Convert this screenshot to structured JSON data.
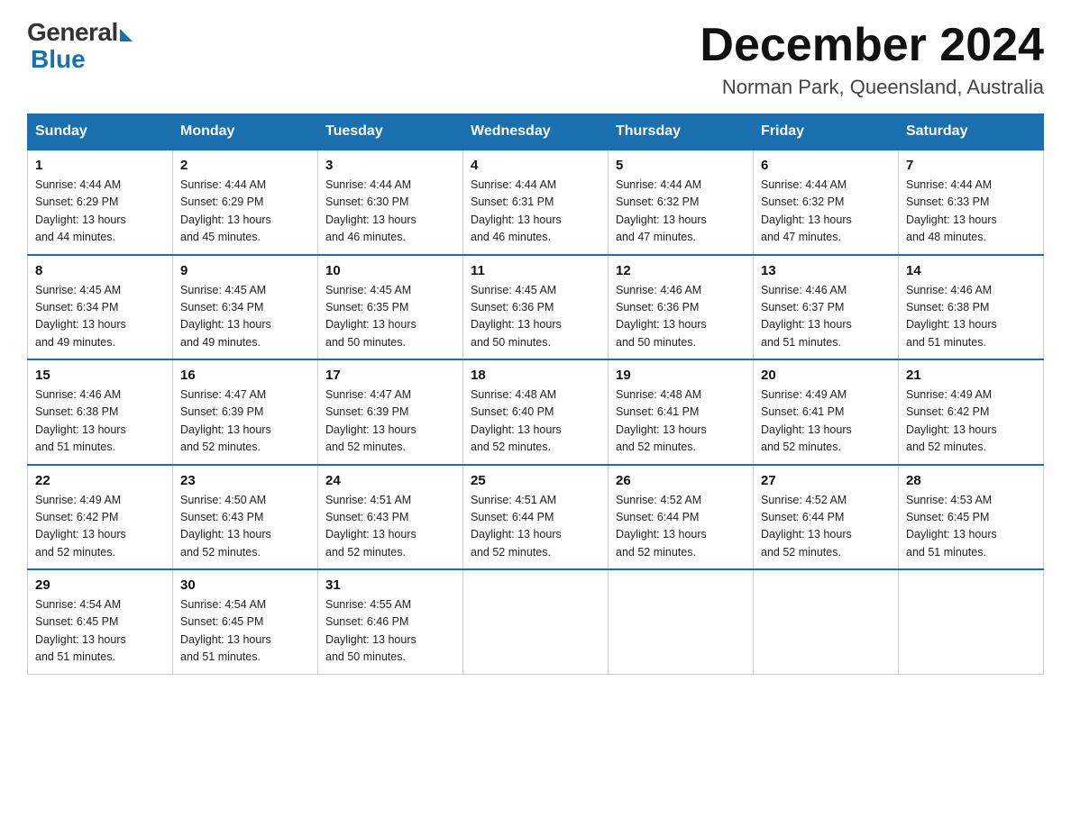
{
  "logo": {
    "general": "General",
    "blue": "Blue"
  },
  "title": "December 2024",
  "location": "Norman Park, Queensland, Australia",
  "days_of_week": [
    "Sunday",
    "Monday",
    "Tuesday",
    "Wednesday",
    "Thursday",
    "Friday",
    "Saturday"
  ],
  "weeks": [
    [
      {
        "day": "1",
        "sunrise": "4:44 AM",
        "sunset": "6:29 PM",
        "daylight": "13 hours and 44 minutes."
      },
      {
        "day": "2",
        "sunrise": "4:44 AM",
        "sunset": "6:29 PM",
        "daylight": "13 hours and 45 minutes."
      },
      {
        "day": "3",
        "sunrise": "4:44 AM",
        "sunset": "6:30 PM",
        "daylight": "13 hours and 46 minutes."
      },
      {
        "day": "4",
        "sunrise": "4:44 AM",
        "sunset": "6:31 PM",
        "daylight": "13 hours and 46 minutes."
      },
      {
        "day": "5",
        "sunrise": "4:44 AM",
        "sunset": "6:32 PM",
        "daylight": "13 hours and 47 minutes."
      },
      {
        "day": "6",
        "sunrise": "4:44 AM",
        "sunset": "6:32 PM",
        "daylight": "13 hours and 47 minutes."
      },
      {
        "day": "7",
        "sunrise": "4:44 AM",
        "sunset": "6:33 PM",
        "daylight": "13 hours and 48 minutes."
      }
    ],
    [
      {
        "day": "8",
        "sunrise": "4:45 AM",
        "sunset": "6:34 PM",
        "daylight": "13 hours and 49 minutes."
      },
      {
        "day": "9",
        "sunrise": "4:45 AM",
        "sunset": "6:34 PM",
        "daylight": "13 hours and 49 minutes."
      },
      {
        "day": "10",
        "sunrise": "4:45 AM",
        "sunset": "6:35 PM",
        "daylight": "13 hours and 50 minutes."
      },
      {
        "day": "11",
        "sunrise": "4:45 AM",
        "sunset": "6:36 PM",
        "daylight": "13 hours and 50 minutes."
      },
      {
        "day": "12",
        "sunrise": "4:46 AM",
        "sunset": "6:36 PM",
        "daylight": "13 hours and 50 minutes."
      },
      {
        "day": "13",
        "sunrise": "4:46 AM",
        "sunset": "6:37 PM",
        "daylight": "13 hours and 51 minutes."
      },
      {
        "day": "14",
        "sunrise": "4:46 AM",
        "sunset": "6:38 PM",
        "daylight": "13 hours and 51 minutes."
      }
    ],
    [
      {
        "day": "15",
        "sunrise": "4:46 AM",
        "sunset": "6:38 PM",
        "daylight": "13 hours and 51 minutes."
      },
      {
        "day": "16",
        "sunrise": "4:47 AM",
        "sunset": "6:39 PM",
        "daylight": "13 hours and 52 minutes."
      },
      {
        "day": "17",
        "sunrise": "4:47 AM",
        "sunset": "6:39 PM",
        "daylight": "13 hours and 52 minutes."
      },
      {
        "day": "18",
        "sunrise": "4:48 AM",
        "sunset": "6:40 PM",
        "daylight": "13 hours and 52 minutes."
      },
      {
        "day": "19",
        "sunrise": "4:48 AM",
        "sunset": "6:41 PM",
        "daylight": "13 hours and 52 minutes."
      },
      {
        "day": "20",
        "sunrise": "4:49 AM",
        "sunset": "6:41 PM",
        "daylight": "13 hours and 52 minutes."
      },
      {
        "day": "21",
        "sunrise": "4:49 AM",
        "sunset": "6:42 PM",
        "daylight": "13 hours and 52 minutes."
      }
    ],
    [
      {
        "day": "22",
        "sunrise": "4:49 AM",
        "sunset": "6:42 PM",
        "daylight": "13 hours and 52 minutes."
      },
      {
        "day": "23",
        "sunrise": "4:50 AM",
        "sunset": "6:43 PM",
        "daylight": "13 hours and 52 minutes."
      },
      {
        "day": "24",
        "sunrise": "4:51 AM",
        "sunset": "6:43 PM",
        "daylight": "13 hours and 52 minutes."
      },
      {
        "day": "25",
        "sunrise": "4:51 AM",
        "sunset": "6:44 PM",
        "daylight": "13 hours and 52 minutes."
      },
      {
        "day": "26",
        "sunrise": "4:52 AM",
        "sunset": "6:44 PM",
        "daylight": "13 hours and 52 minutes."
      },
      {
        "day": "27",
        "sunrise": "4:52 AM",
        "sunset": "6:44 PM",
        "daylight": "13 hours and 52 minutes."
      },
      {
        "day": "28",
        "sunrise": "4:53 AM",
        "sunset": "6:45 PM",
        "daylight": "13 hours and 51 minutes."
      }
    ],
    [
      {
        "day": "29",
        "sunrise": "4:54 AM",
        "sunset": "6:45 PM",
        "daylight": "13 hours and 51 minutes."
      },
      {
        "day": "30",
        "sunrise": "4:54 AM",
        "sunset": "6:45 PM",
        "daylight": "13 hours and 51 minutes."
      },
      {
        "day": "31",
        "sunrise": "4:55 AM",
        "sunset": "6:46 PM",
        "daylight": "13 hours and 50 minutes."
      },
      null,
      null,
      null,
      null
    ]
  ],
  "labels": {
    "sunrise": "Sunrise:",
    "sunset": "Sunset:",
    "daylight": "Daylight:"
  }
}
